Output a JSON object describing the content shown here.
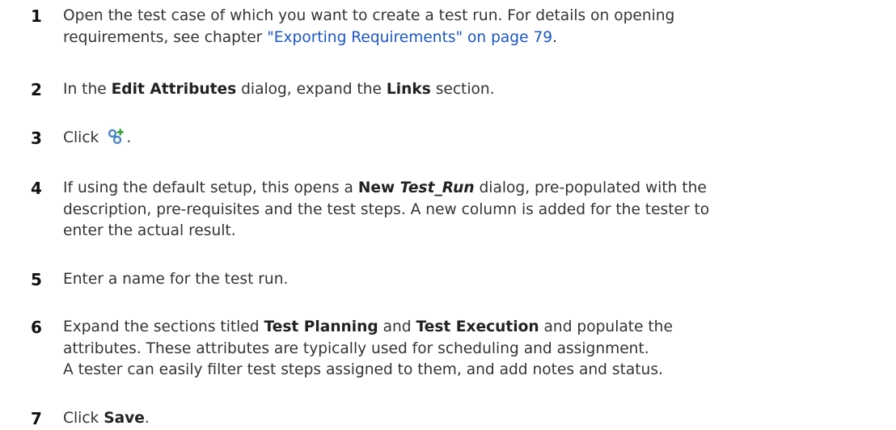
{
  "steps": [
    {
      "number": "1",
      "line1": "Open the test case of which you want to create a test run. For details on opening",
      "line2_before": "requirements, see chapter ",
      "line2_link": "\"Exporting Requirements\" on page 79",
      "line2_after": "."
    },
    {
      "number": "2",
      "t1": "In the ",
      "b1": "Edit Attributes",
      "t2": " dialog, expand the ",
      "b2": "Links",
      "t3": " section."
    },
    {
      "number": "3",
      "t1": "Click",
      "icon": "create-link-icon",
      "t2": "."
    },
    {
      "number": "4",
      "t1": "If using the default setup, this opens a ",
      "b1": "New ",
      "b1_italic": "Test_Run",
      "t2": " dialog, pre-populated with the",
      "line2": "description, pre-requisites and the test steps. A new column is added for the tester to",
      "line3": "enter the actual result."
    },
    {
      "number": "5",
      "t1": "Enter a name for the test run."
    },
    {
      "number": "6",
      "t1": "Expand the sections titled ",
      "b1": "Test Planning",
      "t2": " and ",
      "b2": "Test Execution",
      "t3": " and populate the",
      "line2": "attributes. These attributes are typically used for scheduling and assignment.",
      "line3": "A tester can easily filter test steps assigned to them, and add notes and status."
    },
    {
      "number": "7",
      "t1": "Click ",
      "b1": "Save",
      "t2": "."
    }
  ],
  "colors": {
    "link": "#1a55c8",
    "text": "#333333",
    "icon_blue": "#4a86c8",
    "icon_green": "#3aa63a"
  }
}
